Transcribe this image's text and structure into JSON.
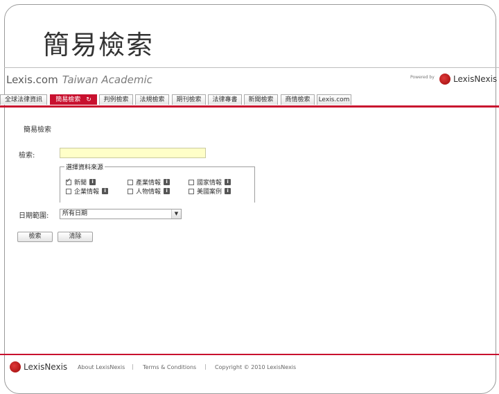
{
  "slide": {
    "title": "簡易檢索"
  },
  "header": {
    "brand": "Lexis.com",
    "brand_sub": "Taiwan Academic",
    "powered_by": "Powered by",
    "logo_text": "LexisNexis"
  },
  "tabs": [
    {
      "label": "全球法律資訊",
      "active": false
    },
    {
      "label": "簡易檢索",
      "active": true
    },
    {
      "label": "判例檢索",
      "active": false
    },
    {
      "label": "法規檢索",
      "active": false
    },
    {
      "label": "期刊檢索",
      "active": false
    },
    {
      "label": "法律專書",
      "active": false
    },
    {
      "label": "新聞檢索",
      "active": false
    },
    {
      "label": "商情檢索",
      "active": false
    },
    {
      "label": "Lexis.com",
      "active": false
    }
  ],
  "form": {
    "section_title": "簡易檢索",
    "search_label": "檢索:",
    "search_value": "",
    "sources_legend": "選擇資料來源",
    "sources": [
      {
        "label": "新聞",
        "checked": true
      },
      {
        "label": "企業情報",
        "checked": false
      },
      {
        "label": "產業情報",
        "checked": false
      },
      {
        "label": "人物情報",
        "checked": false
      },
      {
        "label": "國家情報",
        "checked": false
      },
      {
        "label": "美國案例",
        "checked": false
      }
    ],
    "date_label": "日期範圍:",
    "date_value": "所有日期",
    "search_button": "檢索",
    "clear_button": "清除"
  },
  "footer": {
    "logo_text": "LexisNexis",
    "about": "About LexisNexis",
    "terms": "Terms & Conditions",
    "copyright": "Copyright © 2010 LexisNexis",
    "separator": "|"
  },
  "colors": {
    "accent": "#c8102e",
    "input_highlight": "#ffffc8"
  }
}
